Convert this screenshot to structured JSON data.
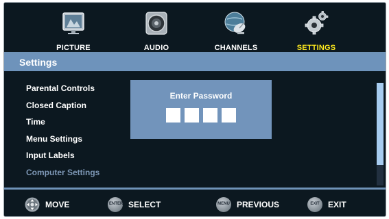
{
  "tabs": [
    {
      "label": "PICTURE",
      "icon": "monitor-icon",
      "active": false
    },
    {
      "label": "AUDIO",
      "icon": "speaker-icon",
      "active": false
    },
    {
      "label": "CHANNELS",
      "icon": "satellite-dish-icon",
      "active": false
    },
    {
      "label": "SETTINGS",
      "icon": "gears-icon",
      "active": true
    }
  ],
  "header": {
    "title": "Settings"
  },
  "menu": [
    {
      "label": "Parental Controls",
      "enabled": true
    },
    {
      "label": "Closed Caption",
      "enabled": true
    },
    {
      "label": "Time",
      "enabled": true
    },
    {
      "label": "Menu Settings",
      "enabled": true
    },
    {
      "label": "Input Labels",
      "enabled": true
    },
    {
      "label": "Computer Settings",
      "enabled": false
    }
  ],
  "dialog": {
    "title": "Enter Password",
    "digits": 4
  },
  "footer": [
    {
      "button": "",
      "icon": "dpad-icon",
      "label": "MOVE"
    },
    {
      "button": "ENTER",
      "icon": "enter-button-icon",
      "label": "SELECT"
    },
    {
      "button": "MENU",
      "icon": "menu-button-icon",
      "label": "PREVIOUS"
    },
    {
      "button": "EXIT",
      "icon": "exit-button-icon",
      "label": "EXIT"
    }
  ],
  "colors": {
    "accent": "#ffea1e",
    "header": "#6e93bb",
    "dialog": "#7294bb",
    "background": "#0c1820",
    "disabled": "#7d97b5"
  }
}
